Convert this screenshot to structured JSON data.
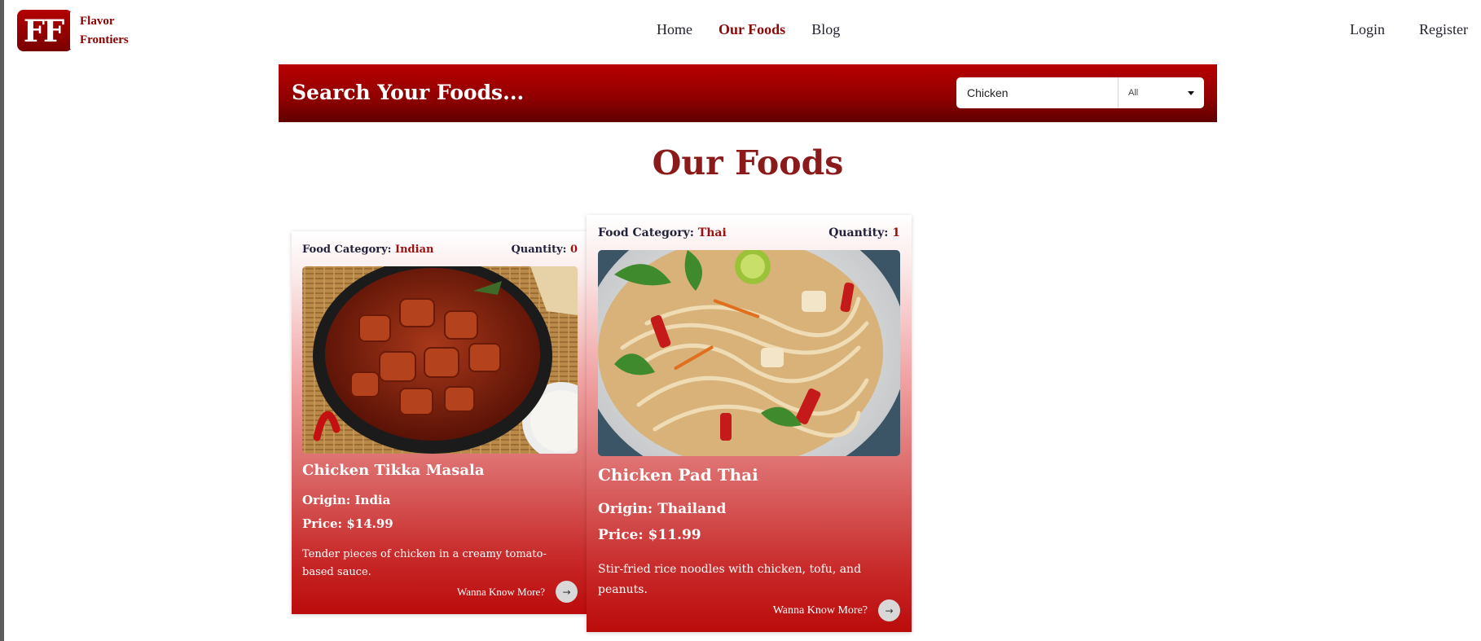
{
  "brand": {
    "initials": "FF",
    "name_line1": "Flavor",
    "name_line2": "Frontiers"
  },
  "nav": [
    {
      "label": "Home",
      "active": false
    },
    {
      "label": "Our Foods",
      "active": true
    },
    {
      "label": "Blog",
      "active": false
    }
  ],
  "auth": {
    "login": "Login",
    "register": "Register"
  },
  "search": {
    "title": "Search Your Foods...",
    "value": "Chicken",
    "filter": "All"
  },
  "page_title": "Our Foods",
  "labels": {
    "category": "Food Category:",
    "quantity": "Quantity:",
    "more": "Wanna Know More?",
    "arrow": "→"
  },
  "foods": [
    {
      "category": "Indian",
      "quantity": "0",
      "name": "Chicken Tikka Masala",
      "origin": "Origin: India",
      "price": "Price: $14.99",
      "description": "Tender pieces of chicken in a creamy tomato-based sauce."
    },
    {
      "category": "Thai",
      "quantity": "1",
      "name": "Chicken Pad Thai",
      "origin": "Origin: Thailand",
      "price": "Price: $11.99",
      "description": "Stir-fried rice noodles with chicken, tofu, and peanuts."
    }
  ],
  "colors": {
    "brand_red": "#8b0000",
    "banner_red": "#b80000",
    "title_red": "#8b1a1a"
  }
}
